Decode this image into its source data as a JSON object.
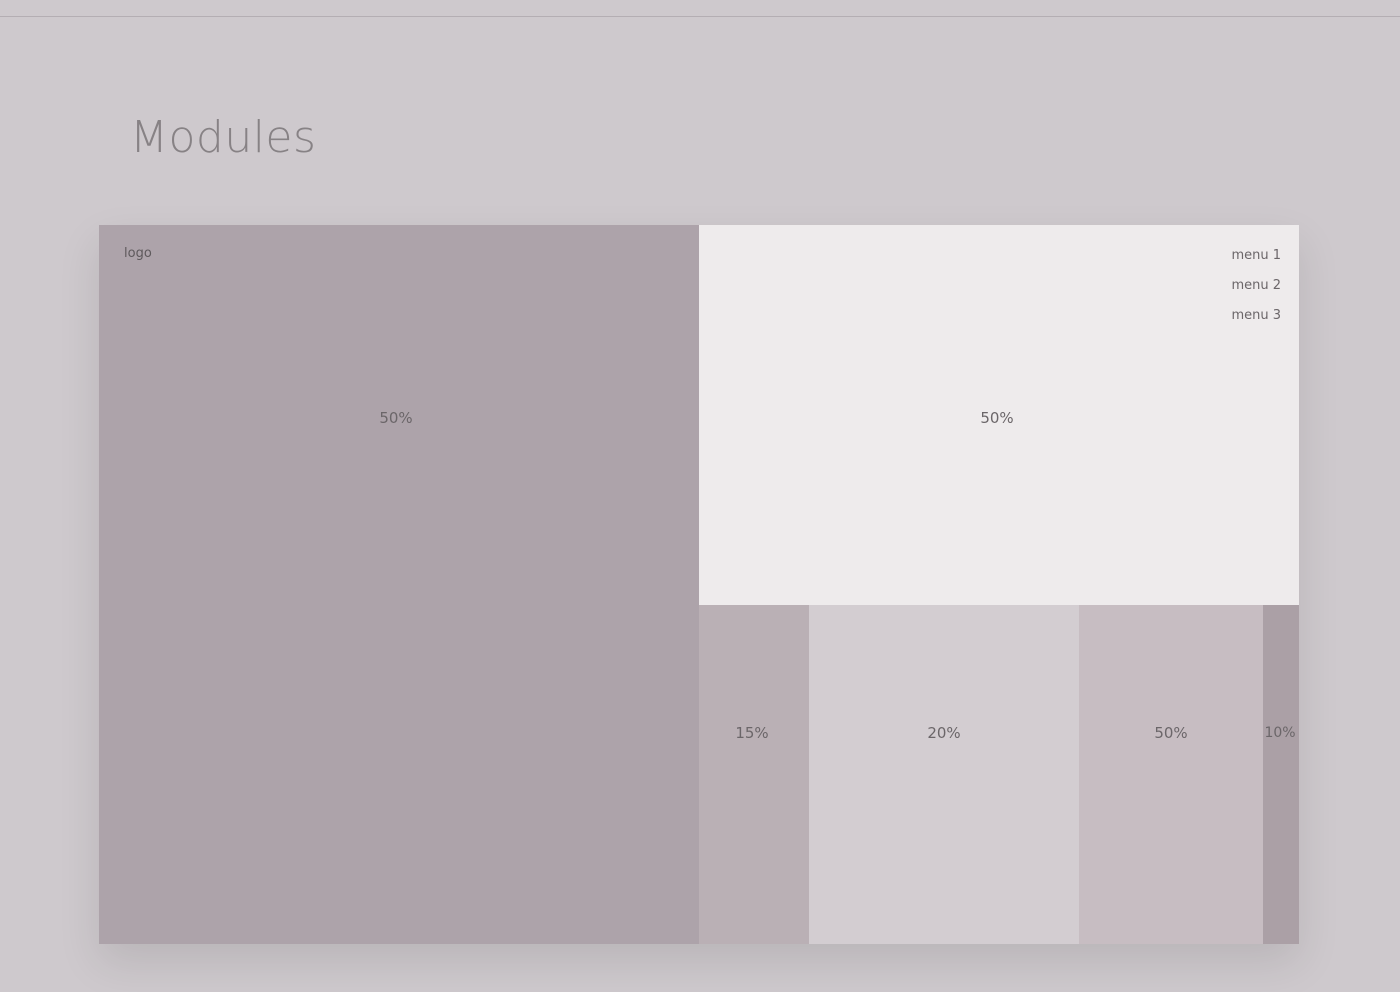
{
  "page": {
    "title": "Modules"
  },
  "colors": {
    "background": "#cec9cd",
    "rule": "#b4aeb3",
    "title": "#878285",
    "label": "#6b6669"
  },
  "modules": {
    "left": {
      "label": "50%",
      "logo": "logo",
      "color": "#ada3aa"
    },
    "right_top": {
      "label": "50%",
      "color": "#eeebec",
      "menu": [
        "menu 1",
        "menu 2",
        "menu 3"
      ]
    },
    "bottom": [
      {
        "label": "15%",
        "color": "#bab0b5"
      },
      {
        "label": "20%",
        "color": "#d3cdd1"
      },
      {
        "label": "50%",
        "color": "#c7bdc2"
      },
      {
        "label": "10%",
        "color": "#aba0a6"
      }
    ]
  }
}
